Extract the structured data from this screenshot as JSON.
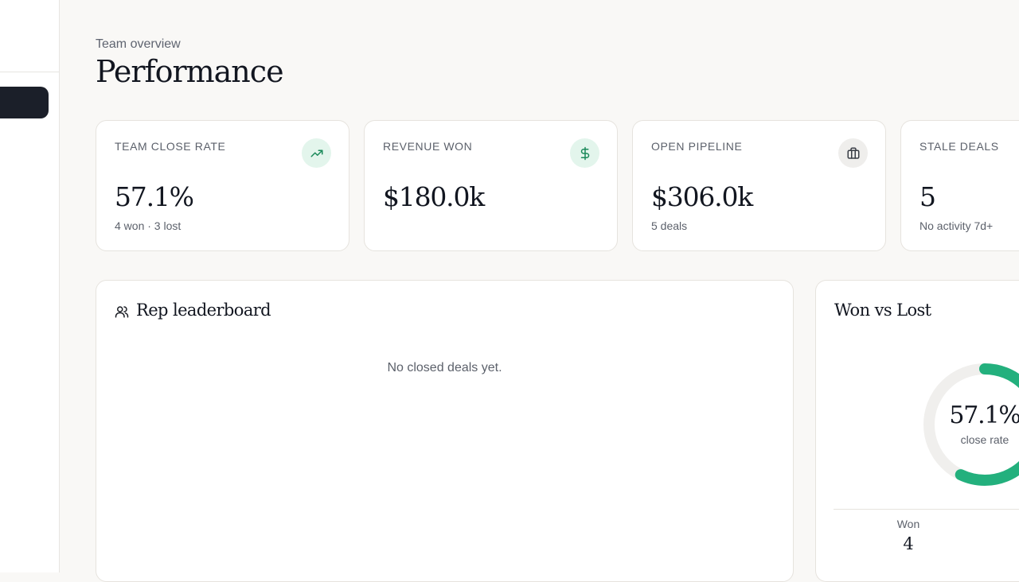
{
  "header": {
    "eyebrow": "Team overview",
    "title": "Performance"
  },
  "stats": [
    {
      "label": "TEAM CLOSE RATE",
      "value": "57.1%",
      "sub": "4 won · 3 lost",
      "icon": "trending-up-icon"
    },
    {
      "label": "REVENUE WON",
      "value": "$180.0k",
      "sub": "",
      "icon": "dollar-icon"
    },
    {
      "label": "OPEN PIPELINE",
      "value": "$306.0k",
      "sub": "5 deals",
      "icon": "briefcase-icon"
    },
    {
      "label": "STALE DEALS",
      "value": "5",
      "sub": "No activity 7d+",
      "icon": ""
    }
  ],
  "leaderboard": {
    "title": "Rep leaderboard",
    "empty_text": "No closed deals yet."
  },
  "won_lost": {
    "title": "Won vs Lost",
    "close_rate": "57.1%",
    "close_rate_caption": "close rate",
    "close_rate_fraction": 0.571,
    "won_label": "Won",
    "won_value": "4"
  },
  "colors": {
    "accent_green": "#23b07d",
    "dark": "#1b1f29",
    "track": "#f0efed"
  }
}
